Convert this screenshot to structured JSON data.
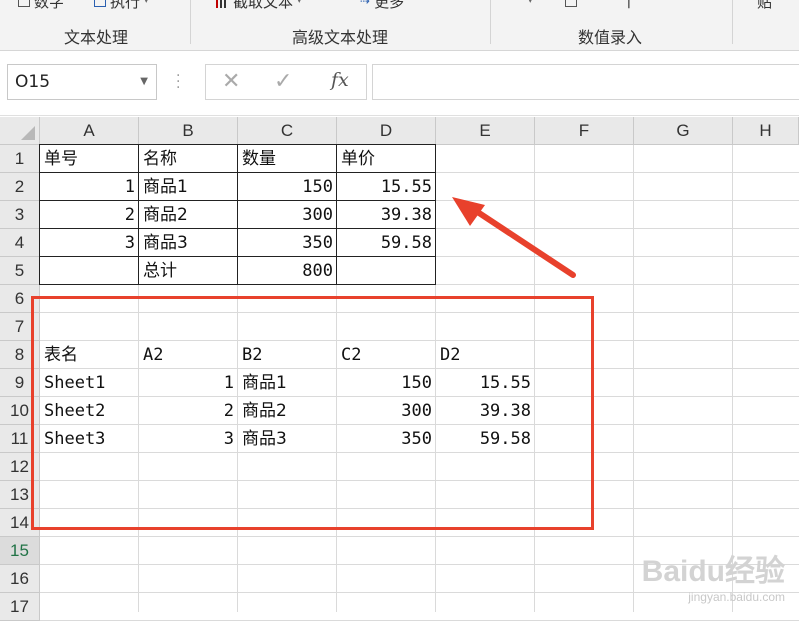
{
  "ribbon": {
    "top_items": [
      "数字",
      "执行",
      "截取文本",
      "更多",
      "贴"
    ],
    "groups": [
      "文本处理",
      "高级文本处理",
      "数值录入"
    ]
  },
  "formula_bar": {
    "name_box": "O15",
    "cancel_icon": "close-icon",
    "enter_icon": "check-icon",
    "fx_label": "fx",
    "content": ""
  },
  "columns": [
    "A",
    "B",
    "C",
    "D",
    "E",
    "F",
    "G",
    "H"
  ],
  "rows": [
    "1",
    "2",
    "3",
    "4",
    "5",
    "6",
    "7",
    "8",
    "9",
    "10",
    "11",
    "12",
    "13",
    "14",
    "15",
    "16",
    "17"
  ],
  "active_row": "15",
  "table1": {
    "headers": [
      "单号",
      "名称",
      "数量",
      "单价"
    ],
    "rows": [
      [
        "1",
        "商品1",
        "150",
        "15.55"
      ],
      [
        "2",
        "商品2",
        "300",
        "39.38"
      ],
      [
        "3",
        "商品3",
        "350",
        "59.58"
      ]
    ],
    "total_label": "总计",
    "total_value": "800"
  },
  "table2": {
    "headers": [
      "表名",
      "A2",
      "B2",
      "C2",
      "D2"
    ],
    "rows": [
      [
        "Sheet1",
        "1",
        "商品1",
        "150",
        "15.55"
      ],
      [
        "Sheet2",
        "2",
        "商品2",
        "300",
        "39.38"
      ],
      [
        "Sheet3",
        "3",
        "商品3",
        "350",
        "59.58"
      ]
    ]
  },
  "annotation": {
    "box_color": "#e8412c",
    "arrow_color": "#e8412c"
  },
  "watermark": {
    "logo": "Baidu经验",
    "url": "jingyan.baidu.com"
  },
  "colors": {
    "accent": "#217346",
    "header_bg": "#e9e9e9"
  }
}
